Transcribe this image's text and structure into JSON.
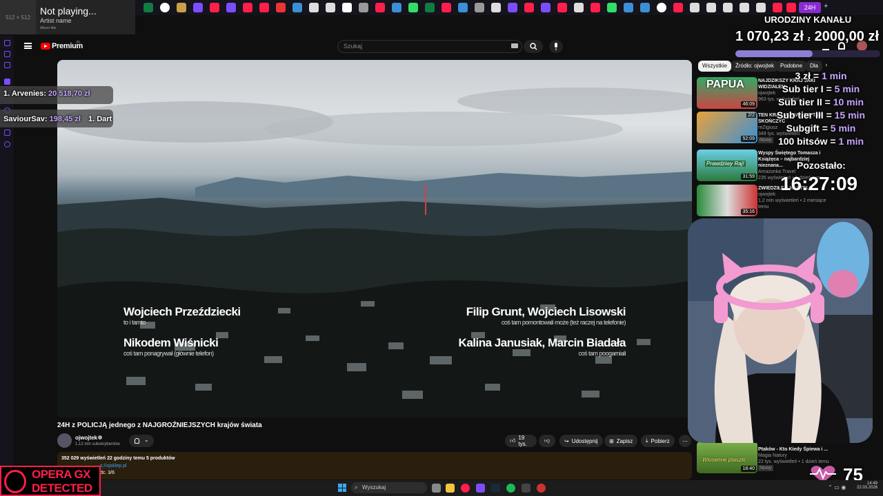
{
  "media_widget": {
    "art_size": "512 × 512",
    "status": "Not playing...",
    "artist": "Artist name",
    "album": "Album title"
  },
  "browser": {
    "active_tab_label": "24H",
    "new_tab": "+"
  },
  "youtube": {
    "logo": "Premium",
    "logo_region": "PL",
    "search_placeholder": "Szukaj",
    "chips": [
      "Wszystkie",
      "Źródło: ojwojtek",
      "Podobne",
      "Dla"
    ],
    "video": {
      "credits": [
        {
          "name": "Wojciech Przeździecki",
          "role": "to i tamto"
        },
        {
          "name": "Nikodem Wiśnicki",
          "role": "coś tam ponagrywał (głównie telefon)"
        },
        {
          "name": "Filip Grunt, Wojciech Lisowski",
          "role": "coś tam pomontowali może (też raczej na telefonie)"
        },
        {
          "name": "Kalina Janusiak, Marcin Biadała",
          "role": "coś tam poogarniali"
        }
      ]
    },
    "title": "24H z POLICJĄ jednego z NAJGROŹNIEJSZYCH krajów świata",
    "channel": {
      "name": "ojwojtek",
      "subscribers": "1,12 mln subskrybentów"
    },
    "actions": {
      "likes": "19 tys.",
      "share": "Udostępnij",
      "save": "Zapisz",
      "download": "Pobierz"
    },
    "description": {
      "stats": "352 029 wyświetleń  22 godziny temu  5 produktów",
      "link": "s://ojsklep.pl",
      "part": "dc. 3/6"
    },
    "recommendations": [
      {
        "title": "NAJDZIKSZY KRAJ JAKI WIDZIAŁEM",
        "channel": "ojwojtek",
        "meta": "963 tys. wyświetleń",
        "duration": "46:09",
        "thumb_text": "PAPUA"
      },
      {
        "title": "TEN KRAJ MUSIAŁ SIĘ TAK SKOŃCZYĆ",
        "channel": "reZigiusz",
        "meta": "349 tys. wyświetleń",
        "badge": "Nowy",
        "duration": "52:09",
        "progress": "2/2"
      },
      {
        "title": "Wyspy Świętego Tomasza i Książęca – najbardziej nieznana...",
        "channel": "Amazonka Travel",
        "meta": "235 wyświetleń • 1 dzień temu",
        "duration": "31:59",
        "thumb_text": "Prawdziwy Raj!"
      },
      {
        "title": "ZWIEDZIŁEM KARTELI",
        "channel": "ojwojtek",
        "meta": "1,2 mln wyświetleń • 2 miesiące temu",
        "duration": "35:16"
      },
      {
        "title": "Ptaków - Kto Kiedy Śpiewa i ...",
        "channel": "Magia Natury",
        "meta": "22 tys. wyświetleń • 1 dzień temu",
        "badge": "Nowy",
        "duration": "18:40",
        "thumb_text": "Wiosenne ptaszki"
      }
    ]
  },
  "overlay": {
    "leaderboard": [
      {
        "name": "1. Arvenies:",
        "amount": "20 518,70 zł"
      },
      {
        "name": "SaviourSav:",
        "amount": "198,45 zł",
        "extra": "1. Dart"
      }
    ],
    "goal_title": "URODZINY KANAŁU",
    "goal_current": "1 070,23 zł",
    "goal_sep": "z",
    "goal_target": "2000,00 zł",
    "goal_progress": 0.535,
    "rates": [
      {
        "left": "3 zł = ",
        "right": "1 min"
      },
      {
        "left": "Sub tier I = ",
        "right": "5 min"
      },
      {
        "left": "Sub tier II = ",
        "right": "10 min"
      },
      {
        "left": "Sub tier III = ",
        "right": "15 min"
      },
      {
        "left": "Subgift = ",
        "right": "5 min"
      },
      {
        "left": "100 bitsów = ",
        "right": "1 min"
      }
    ],
    "remaining_label": "Pozostało:",
    "remaining_time": "16:27:09",
    "heart_rate": "75",
    "opera_line1": "OPERA GX",
    "opera_line2": "DETECTED"
  },
  "taskbar": {
    "search": "Wyszukaj",
    "time": "14:49",
    "date": "22.03.2026"
  },
  "colors": {
    "accent_purple": "#8a2bd1",
    "yt_red": "#ff0000",
    "opera_red": "#ff1f4a",
    "overlay_purple": "#c8a6ff"
  }
}
